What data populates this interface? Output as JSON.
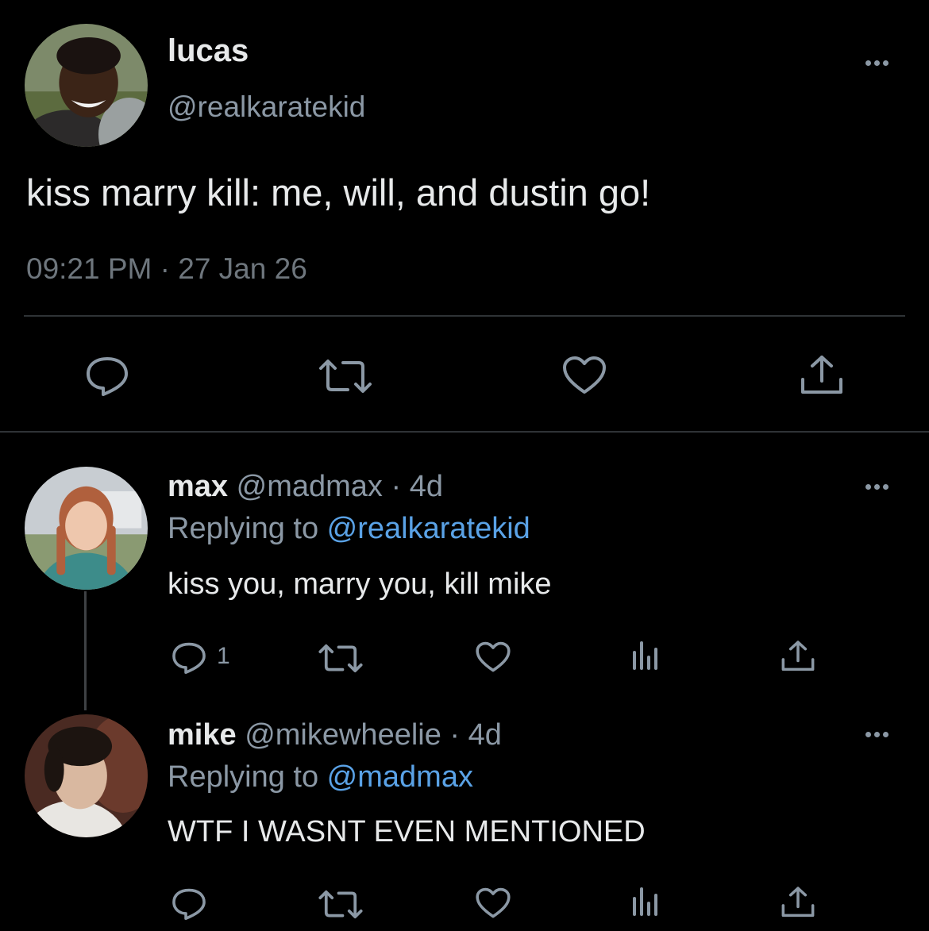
{
  "main_tweet": {
    "name": "lucas",
    "handle": "@realkaratekid",
    "text": "kiss marry kill: me, will, and dustin go!",
    "timestamp": "09:21 PM · 27 Jan 26",
    "actions": [
      "reply-icon",
      "retweet-icon",
      "like-icon",
      "share-icon"
    ]
  },
  "replies": [
    {
      "name": "max",
      "handle": "@madmax",
      "age": "· 4d",
      "replying_prefix": "Replying to ",
      "replying_to": "@realkaratekid",
      "text": "kiss you, marry you, kill mike",
      "reply_count": "1"
    },
    {
      "name": "mike",
      "handle": "@mikewheelie",
      "age": "· 4d",
      "replying_prefix": "Replying to ",
      "replying_to": "@madmax",
      "text": "WTF I WASNT EVEN MENTIONED",
      "reply_count": ""
    }
  ],
  "colors": {
    "background": "#000000",
    "primary_text": "#e7e9ea",
    "secondary_text": "#8b98a5",
    "link": "#5aa2e6",
    "divider": "#2f3336"
  }
}
